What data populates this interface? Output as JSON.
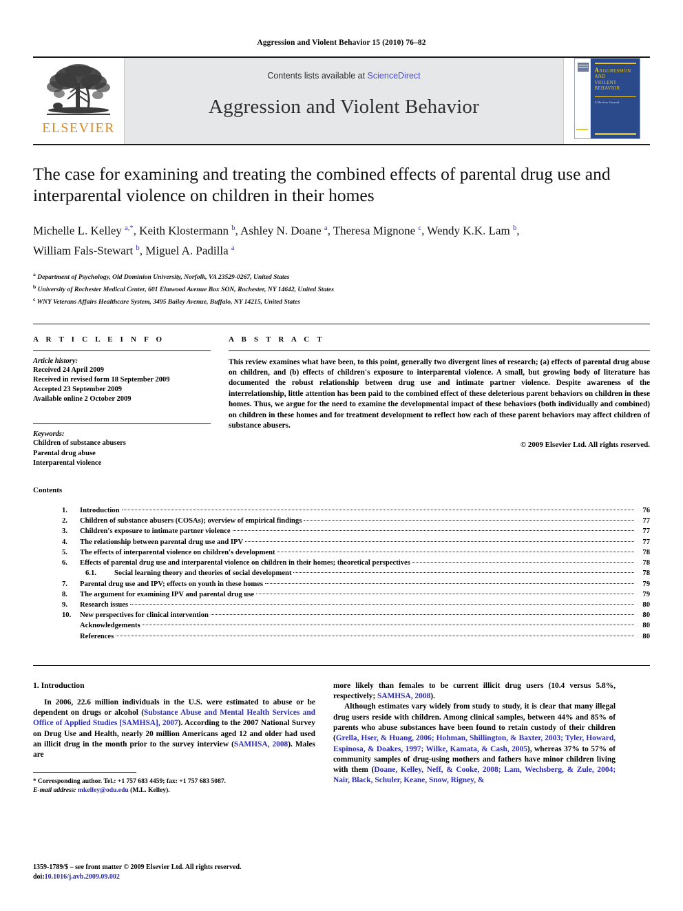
{
  "running_head": "Aggression and Violent Behavior 15 (2010) 76–82",
  "masthead": {
    "publisher_name": "ELSEVIER",
    "contents_prefix": "Contents lists available at ",
    "sciencedirect": "ScienceDirect",
    "journal_title": "Aggression and Violent Behavior",
    "cover": {
      "line1": "AGGRESSION",
      "line2": "AND",
      "line3": "VIOLENT",
      "line4": "BEHAVIOR",
      "subtitle": "A Review Journal"
    }
  },
  "article": {
    "title": "The case for examining and treating the combined effects of parental drug use and interparental violence on children in their homes",
    "authors_line1": "Michelle L. Kelley <sup>a,*</sup>, Keith Klostermann <sup>b</sup>, Ashley N. Doane <sup>a</sup>, Theresa Mignone <sup>c</sup>, Wendy K.K. Lam <sup>b</sup>,",
    "authors_line2": "William Fals-Stewart <sup>b</sup>, Miguel A. Padilla <sup>a</sup>",
    "affiliations": [
      {
        "marker": "a",
        "text": "Department of Psychology, Old Dominion University, Norfolk, VA 23529-0267, United States"
      },
      {
        "marker": "b",
        "text": "University of Rochester Medical Center, 601 Elmwood Avenue Box SON, Rochester, NY 14642, United States"
      },
      {
        "marker": "c",
        "text": "WNY Veterans Affairs Healthcare System, 3495 Bailey Avenue, Buffalo, NY 14215, United States"
      }
    ]
  },
  "article_info": {
    "heading": "A R T I C L E   I N F O",
    "history_label": "Article history:",
    "history": [
      "Received 24 April 2009",
      "Received in revised form 18 September 2009",
      "Accepted 23 September 2009",
      "Available online 2 October 2009"
    ],
    "keywords_label": "Keywords:",
    "keywords": [
      "Children of substance abusers",
      "Parental drug abuse",
      "Interparental violence"
    ]
  },
  "abstract": {
    "heading": "A B S T R A C T",
    "text": "This review examines what have been, to this point, generally two divergent lines of research; (a) effects of parental drug abuse on children, and (b) effects of children's exposure to interparental violence. A small, but growing body of literature has documented the robust relationship between drug use and intimate partner violence. Despite awareness of the interrelationship, little attention has been paid to the combined effect of these deleterious parent behaviors on children in these homes. Thus, we argue for the need to examine the developmental impact of these behaviors (both individually and combined) on children in these homes and for treatment development to reflect how each of these parent behaviors may affect children of substance abusers.",
    "copyright": "© 2009 Elsevier Ltd. All rights reserved."
  },
  "contents": {
    "heading": "Contents",
    "entries": [
      {
        "num": "1.",
        "sub": false,
        "text": "Introduction",
        "page": "76"
      },
      {
        "num": "2.",
        "sub": false,
        "text": "Children of substance abusers (COSAs); overview of empirical findings",
        "page": "77"
      },
      {
        "num": "3.",
        "sub": false,
        "text": "Children's exposure to intimate partner violence",
        "page": "77"
      },
      {
        "num": "4.",
        "sub": false,
        "text": "The relationship between parental drug use and IPV",
        "page": "77"
      },
      {
        "num": "5.",
        "sub": false,
        "text": "The effects of interparental violence on children's development",
        "page": "78"
      },
      {
        "num": "6.",
        "sub": false,
        "text": "Effects of parental drug use and interparental violence on children in their homes; theoretical perspectives",
        "page": "78"
      },
      {
        "num": "6.1.",
        "sub": true,
        "text": "Social learning theory and theories of social development",
        "page": "78"
      },
      {
        "num": "7.",
        "sub": false,
        "text": "Parental drug use and IPV; effects on youth in these homes",
        "page": "79"
      },
      {
        "num": "8.",
        "sub": false,
        "text": "The argument for examining IPV and parental drug use",
        "page": "79"
      },
      {
        "num": "9.",
        "sub": false,
        "text": "Research issues",
        "page": "80"
      },
      {
        "num": "10.",
        "sub": false,
        "text": "New perspectives for clinical intervention",
        "page": "80"
      },
      {
        "num": "",
        "sub": false,
        "text": "Acknowledgements",
        "page": "80"
      },
      {
        "num": "",
        "sub": false,
        "text": "References",
        "page": "80"
      }
    ]
  },
  "body": {
    "section_heading": "1. Introduction",
    "left_paragraph_html": "In 2006, 22.6 million individuals in the U.S. were estimated to abuse or be dependent on drugs or alcohol (<span class=\"cite\">Substance Abuse and Mental Health Services and Office of Applied Studies [SAMHSA], 2007</span>). According to the 2007 National Survey on Drug Use and Health, nearly 20 million Americans aged 12 and older had used an illicit drug in the month prior to the survey interview (<span class=\"cite\">SAMHSA, 2008</span>). Males are",
    "right_paragraph1_html": "more likely than females to be current illicit drug users (10.4 versus 5.8%, respectively; <span class=\"cite\">SAMHSA, 2008</span>).",
    "right_paragraph2_html": "Although estimates vary widely from study to study, it is clear that many illegal drug users reside with children. Among clinical samples, between 44% and 85% of parents who abuse substances have been found to retain custody of their children (<span class=\"cite\">Grella, Hser, &amp; Huang, 2006; Hohman, Shillington, &amp; Baxter, 2003; Tyler, Howard, Espinosa, &amp; Doakes, 1997; Wilke, Kamata, &amp; Cash, 2005</span>), whereas 37% to 57% of community samples of drug-using mothers and fathers have minor children living with them (<span class=\"cite\">Doane, Kelley, Neff, &amp; Cooke, 2008; Lam, Wechsberg, &amp; Zule, 2004; Nair, Black, Schuler, Keane, Snow, Rigney, &amp;</span>"
  },
  "footnote": {
    "corresponding_html": "<span class=\"star\">*</span> Corresponding author. Tel.: +1 757 683 4459; fax: +1 757 683 5087.",
    "email_label": "E-mail address:",
    "email": "mkelley@odu.edu",
    "email_owner": "(M.L. Kelley)."
  },
  "footer": {
    "issn_line": "1359-1789/$ – see front matter © 2009 Elsevier Ltd. All rights reserved.",
    "doi_label": "doi:",
    "doi": "10.1016/j.avb.2009.09.002"
  }
}
